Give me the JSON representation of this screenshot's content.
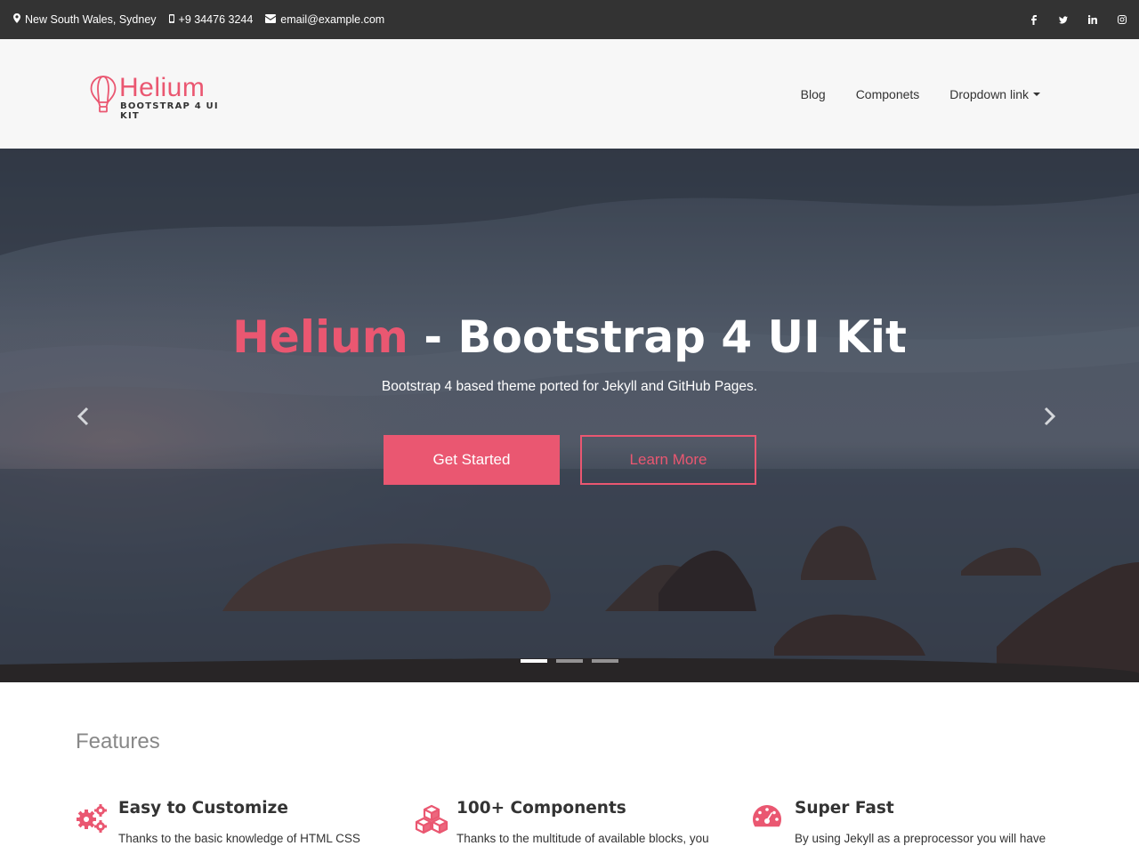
{
  "topbar": {
    "location": "New South Wales, Sydney",
    "phone": "+9 34476 3244",
    "email": "email@example.com",
    "social": [
      "facebook-icon",
      "twitter-icon",
      "linkedin-icon",
      "instagram-icon"
    ]
  },
  "brand": {
    "name": "Helium",
    "tagline": "BOOTSTRAP 4 UI KIT",
    "accent": "#ea5771"
  },
  "nav": {
    "items": [
      {
        "label": "Blog"
      },
      {
        "label": "Componets"
      },
      {
        "label": "Dropdown link"
      }
    ]
  },
  "hero": {
    "title_accent": "Helium",
    "title_rest": " - Bootstrap 4 UI Kit",
    "subtitle": "Bootstrap 4 based theme ported for Jekyll and GitHub Pages.",
    "primary_button": "Get Started",
    "secondary_button": "Learn More",
    "slides": 3,
    "active_slide": 1
  },
  "features": {
    "title": "Features",
    "items": [
      {
        "icon": "gears-icon",
        "title": "Easy to Customize",
        "text": "Thanks to the basic knowledge of HTML CSS"
      },
      {
        "icon": "cubes-icon",
        "title": "100+ Components",
        "text": "Thanks to the multitude of available blocks, you"
      },
      {
        "icon": "dashboard-icon",
        "title": "Super Fast",
        "text": "By using Jekyll as a preprocessor you will have"
      }
    ]
  },
  "colors": {
    "topbar_bg": "#333333",
    "navbar_bg": "#f7f7f7",
    "accent": "#ea5771"
  }
}
